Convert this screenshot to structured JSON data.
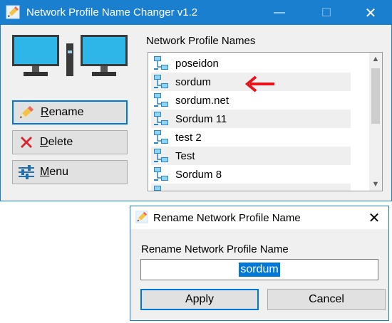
{
  "main_window": {
    "title": "Network Profile Name Changer v1.2",
    "controls": {
      "minimize": "—",
      "maximize": "☐",
      "close": "✕"
    }
  },
  "sidebar": {
    "buttons": [
      {
        "label": "Rename",
        "icon": "pencil-icon",
        "focused": true
      },
      {
        "label": "Delete",
        "icon": "red-x-icon",
        "focused": false
      },
      {
        "label": "Menu",
        "icon": "sliders-icon",
        "focused": false
      }
    ]
  },
  "profiles": {
    "heading": "Network Profile Names",
    "items": [
      "poseidon",
      "sordum",
      "sordum.net",
      "Sordum 11",
      "test 2",
      "Test",
      "Sordum 8"
    ],
    "pointer_target": "sordum"
  },
  "rename_dialog": {
    "title": "Rename Network Profile Name",
    "close": "✕",
    "field_label": "Rename Network Profile Name",
    "field_value": "sordum",
    "apply_label": "Apply",
    "cancel_label": "Cancel"
  },
  "colors": {
    "titlebar": "#1b7fd0",
    "focus_border": "#0078d7",
    "arrow": "#e8141c",
    "monitor_screen": "#2eb6e8"
  }
}
